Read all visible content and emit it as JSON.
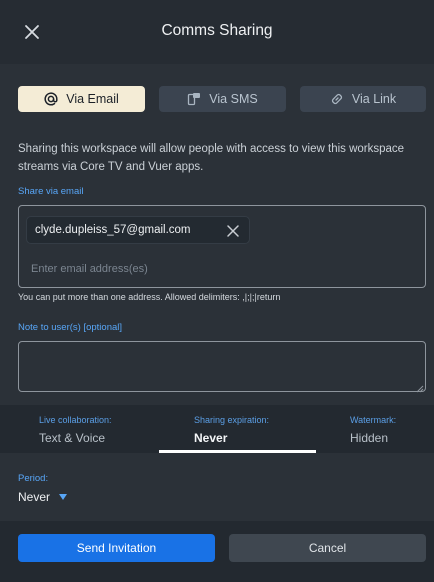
{
  "header": {
    "title": "Comms Sharing"
  },
  "tabs": [
    {
      "label": "Via Email",
      "icon": "at-icon",
      "active": true
    },
    {
      "label": "Via SMS",
      "icon": "sms-icon",
      "active": false
    },
    {
      "label": "Via Link",
      "icon": "link-icon",
      "active": false
    }
  ],
  "description": "Sharing this workspace will allow people with access to view this workspace streams via Core TV and Vuer apps.",
  "email": {
    "label": "Share via email",
    "chip": "clyde.dupleiss_57@gmail.com",
    "placeholder": "Enter email address(es)",
    "value": "",
    "hint": "You can put more than one address. Allowed delimiters: ,|;|;|return"
  },
  "note": {
    "label": "Note to user(s) [optional]",
    "value": ""
  },
  "settings": [
    {
      "key": "Live collaboration:",
      "value": "Text & Voice"
    },
    {
      "key": "Sharing expiration:",
      "value": "Never"
    },
    {
      "key": "Watermark:",
      "value": "Hidden"
    }
  ],
  "period": {
    "label": "Period:",
    "value": "Never"
  },
  "buttons": {
    "send": "Send Invitation",
    "cancel": "Cancel"
  },
  "colors": {
    "accent": "#1972e6",
    "link_label": "#58a6f7",
    "active_tab": "#f4ecd6",
    "background": "#2b3138"
  }
}
